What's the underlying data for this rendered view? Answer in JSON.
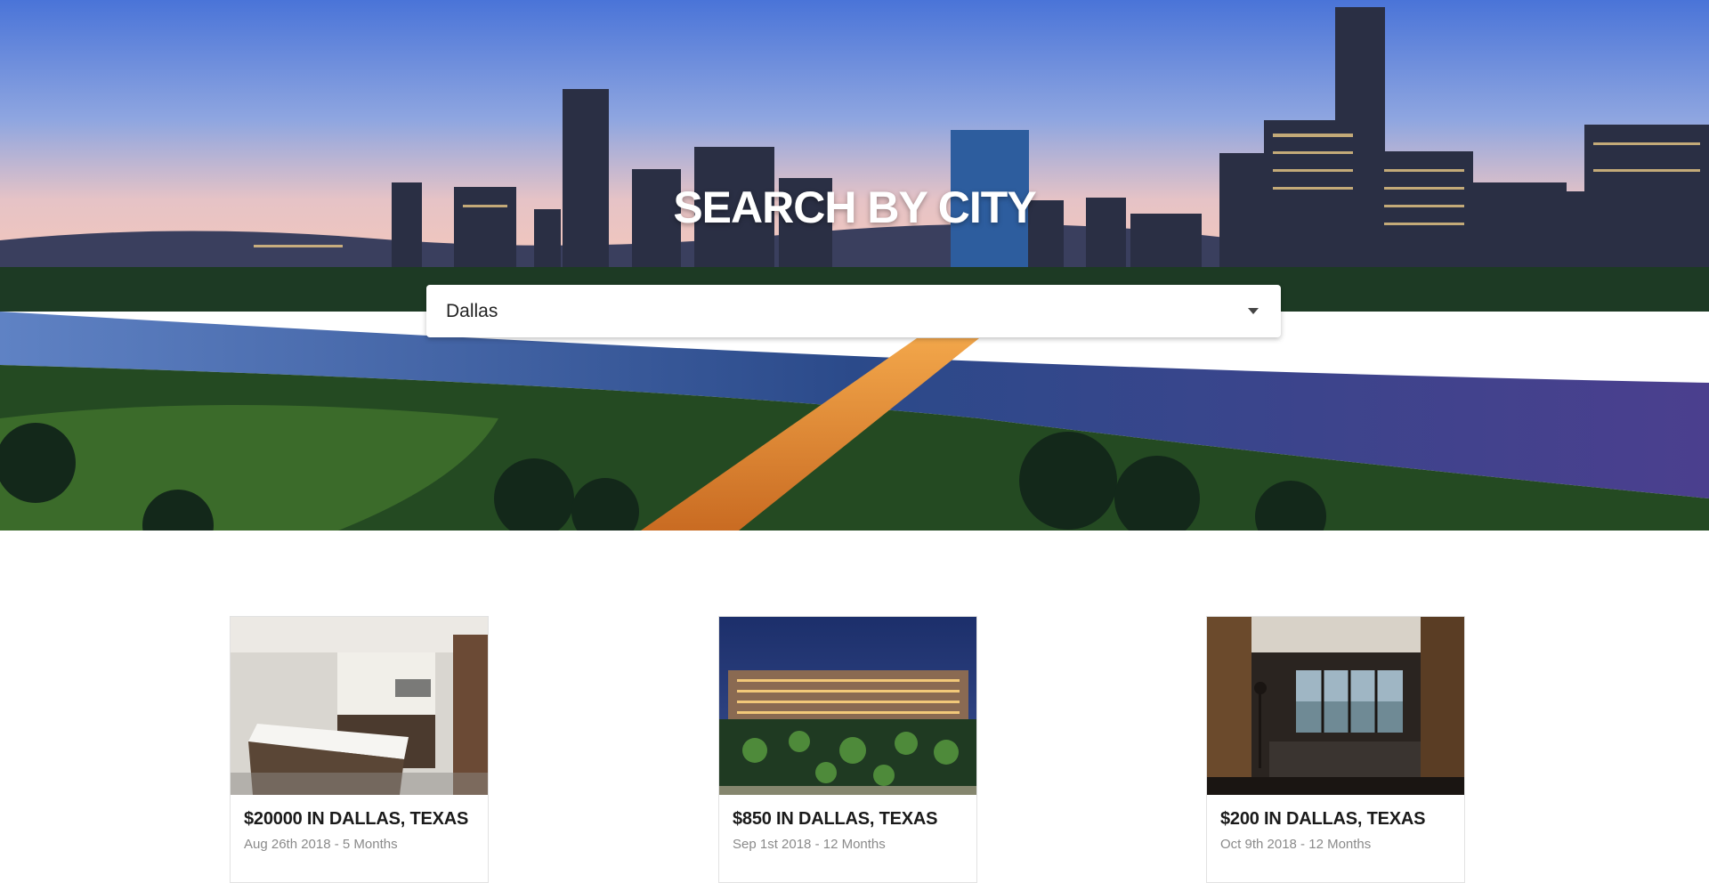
{
  "hero": {
    "title": "SEARCH BY CITY",
    "image": "city-skyline-at-dusk"
  },
  "city_select": {
    "selected": "Dallas",
    "icon": "caret-down-icon"
  },
  "listings": [
    {
      "title": "$20000 IN DALLAS, TEXAS",
      "subtitle": "Aug 26th 2018 - 5 Months",
      "image": "modern-kitchen-photo"
    },
    {
      "title": "$850 IN DALLAS, TEXAS",
      "subtitle": "Sep 1st 2018 - 12 Months",
      "image": "apartment-complex-night-photo"
    },
    {
      "title": "$200 IN DALLAS, TEXAS",
      "subtitle": "Oct 9th 2018 - 12 Months",
      "image": "cabin-living-room-photo"
    }
  ],
  "colors": {
    "sky_top": "#4a74d8",
    "sky_horizon": "#f3c7bb",
    "river": "#3d5fa8",
    "park": "#3b6b2a",
    "card_border": "#e2e2e2",
    "subtitle": "#8a8a8a"
  }
}
